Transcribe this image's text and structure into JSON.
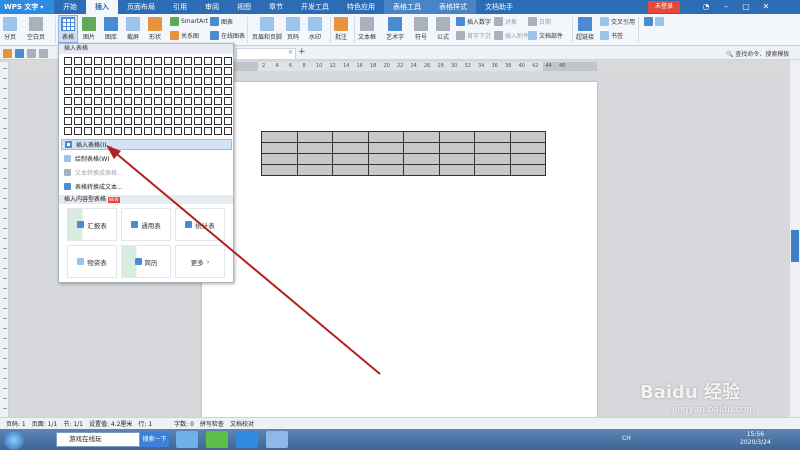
{
  "titlebar": {
    "app_name": "WPS 文字",
    "tabs": [
      "开始",
      "插入",
      "页面布局",
      "引用",
      "审阅",
      "视图",
      "章节",
      "开发工具",
      "特色应用",
      "表格工具",
      "表格样式",
      "文档助手"
    ],
    "active_tab": "插入",
    "signin": "未登录"
  },
  "ribbon": {
    "page": "分页",
    "blank_page": "空白页",
    "table": "表格",
    "picture": "图片",
    "gallery": "图库",
    "screenshot": "截屏",
    "shape": "形状",
    "smartart": "SmartArt",
    "chart": "图表",
    "relation": "关系图",
    "online_chart": "在线图表",
    "header_footer": "页眉和页脚",
    "page_number": "页码",
    "watermark": "水印",
    "comment": "批注",
    "textbox": "文本框",
    "wordart": "艺术字",
    "symbol": "符号",
    "formula": "公式",
    "insert_number": "插入数字",
    "object": "对象",
    "date": "日期",
    "first_drop": "首字下沉",
    "attachment": "插入附件",
    "doc_parts": "文档部件",
    "hyperlink": "超链接",
    "cross_ref": "交叉引用",
    "bookmark": "书签"
  },
  "qbar": {
    "search_cmd": "查找命令、搜索模板"
  },
  "ruler": {
    "ticks": [
      "2",
      "4",
      "6",
      "8",
      "10",
      "12",
      "14",
      "16",
      "18",
      "20",
      "22",
      "24",
      "26",
      "28",
      "30",
      "32",
      "34",
      "36",
      "38",
      "40",
      "42",
      "44",
      "46"
    ]
  },
  "dropdown": {
    "header": "插入表格",
    "items": [
      {
        "label": "插入表格(I)...",
        "disabled": false
      },
      {
        "label": "绘制表格(W)",
        "disabled": false
      },
      {
        "label": "文本转换成表格...",
        "disabled": true
      },
      {
        "label": "表格转换成文本...",
        "disabled": false
      }
    ],
    "content_header": "插入内容型表格",
    "new_badge": "NEW",
    "templates": [
      "汇报表",
      "通用表",
      "统计表",
      "物资表",
      "简历",
      "更多"
    ]
  },
  "statusbar": {
    "page_num": "页码: 1",
    "pages": "页面: 1/1",
    "section": "节: 1/1",
    "position": "设置值: 4.2厘米",
    "row": "行: 1",
    "words": "字数: 0",
    "spell": "拼写检查",
    "doc_check": "文档校对"
  },
  "taskbar": {
    "input_text": "游戏在线玩",
    "search_button": "搜索一下",
    "time": "15:56",
    "date": "2020/3/24",
    "tray": "CH"
  },
  "watermark": {
    "brand": "Baidu 经验",
    "sub": "jingyan.baidu.com"
  },
  "colors": {
    "titlebar": "#2b6cb4",
    "arrow": "#b22020",
    "accent_red": "#e34a3b"
  }
}
